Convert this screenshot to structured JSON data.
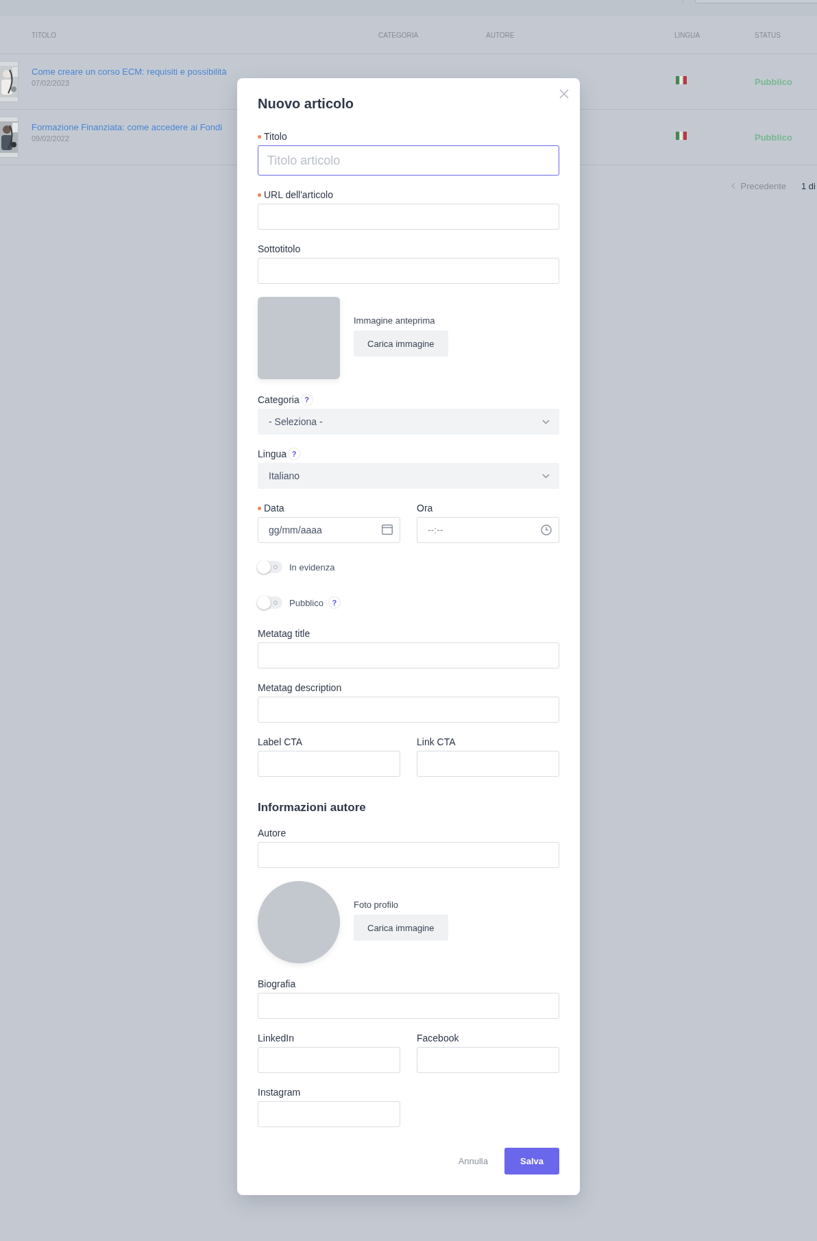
{
  "table": {
    "columns": [
      "TITOLO",
      "CATEGORIA",
      "AUTORE",
      "LINGUA",
      "STATUS"
    ],
    "rows": [
      {
        "title": "Come creare un corso ECM: requisiti e possibilità",
        "date": "07/02/2023",
        "status": "Pubblico"
      },
      {
        "title": "Formazione Finanziata: come accedere ai Fondi",
        "date": "09/02/2022",
        "status": "Pubblico"
      }
    ]
  },
  "pagination": {
    "previous": "Precedente",
    "page": "1 di"
  },
  "modal": {
    "title": "Nuovo articolo",
    "items": [
      {
        "kind": "text",
        "label": "Titolo",
        "required": true,
        "placeholder": "Titolo articolo",
        "focused": true
      },
      {
        "kind": "text",
        "label": "URL dell'articolo",
        "required": true,
        "focused": false
      },
      {
        "kind": "text",
        "label": "Sottotitolo",
        "required": false,
        "focused": false
      },
      {
        "kind": "preview",
        "label": "Immagine anteprima",
        "button": "Carica immagine"
      },
      {
        "kind": "select",
        "label": "Categoria",
        "help": "?",
        "value": "- Seleziona -"
      },
      {
        "kind": "select",
        "label": "Lingua",
        "help": "?",
        "value": "Italiano"
      },
      {
        "kind": "pair",
        "fields": [
          {
            "kind": "date",
            "label": "Data",
            "required": true,
            "placeholder": "gg/mm/aaaa"
          },
          {
            "kind": "time",
            "label": "Ora",
            "required": false,
            "placeholder": "--:--"
          }
        ]
      },
      {
        "kind": "toggle",
        "label": "In evidenza",
        "on": false
      },
      {
        "kind": "toggle",
        "label": "Pubblico",
        "on": false,
        "help": "?"
      },
      {
        "kind": "text",
        "label": "Metatag title",
        "required": false,
        "focused": false
      },
      {
        "kind": "text",
        "label": "Metatag description",
        "required": false,
        "focused": false
      },
      {
        "kind": "pair",
        "fields": [
          {
            "kind": "text",
            "label": "Label CTA",
            "required": false,
            "focused": false
          },
          {
            "kind": "text",
            "label": "Link CTA",
            "required": false,
            "focused": false
          }
        ]
      },
      {
        "kind": "heading",
        "text": "Informazioni autore"
      },
      {
        "kind": "text",
        "label": "Autore",
        "required": false,
        "focused": false
      },
      {
        "label": "Foto profilo",
        "button": "Carica immagine"
      },
      {
        "kind": "text",
        "label": "Biografia",
        "required": false,
        "focused": false
      },
      {
        "kind": "pair",
        "fields": [
          {
            "kind": "text",
            "label": "LinkedIn",
            "required": false,
            "focused": false
          },
          {
            "kind": "text",
            "label": "Facebook",
            "required": false,
            "focused": false
          }
        ]
      },
      {
        "kind": "pair",
        "fields": [
          {
            "kind": "text",
            "label": "Instagram",
            "required": false,
            "focused": false
          }
        ]
      }
    ],
    "cancel": "Annulla",
    "save": "Salva"
  }
}
